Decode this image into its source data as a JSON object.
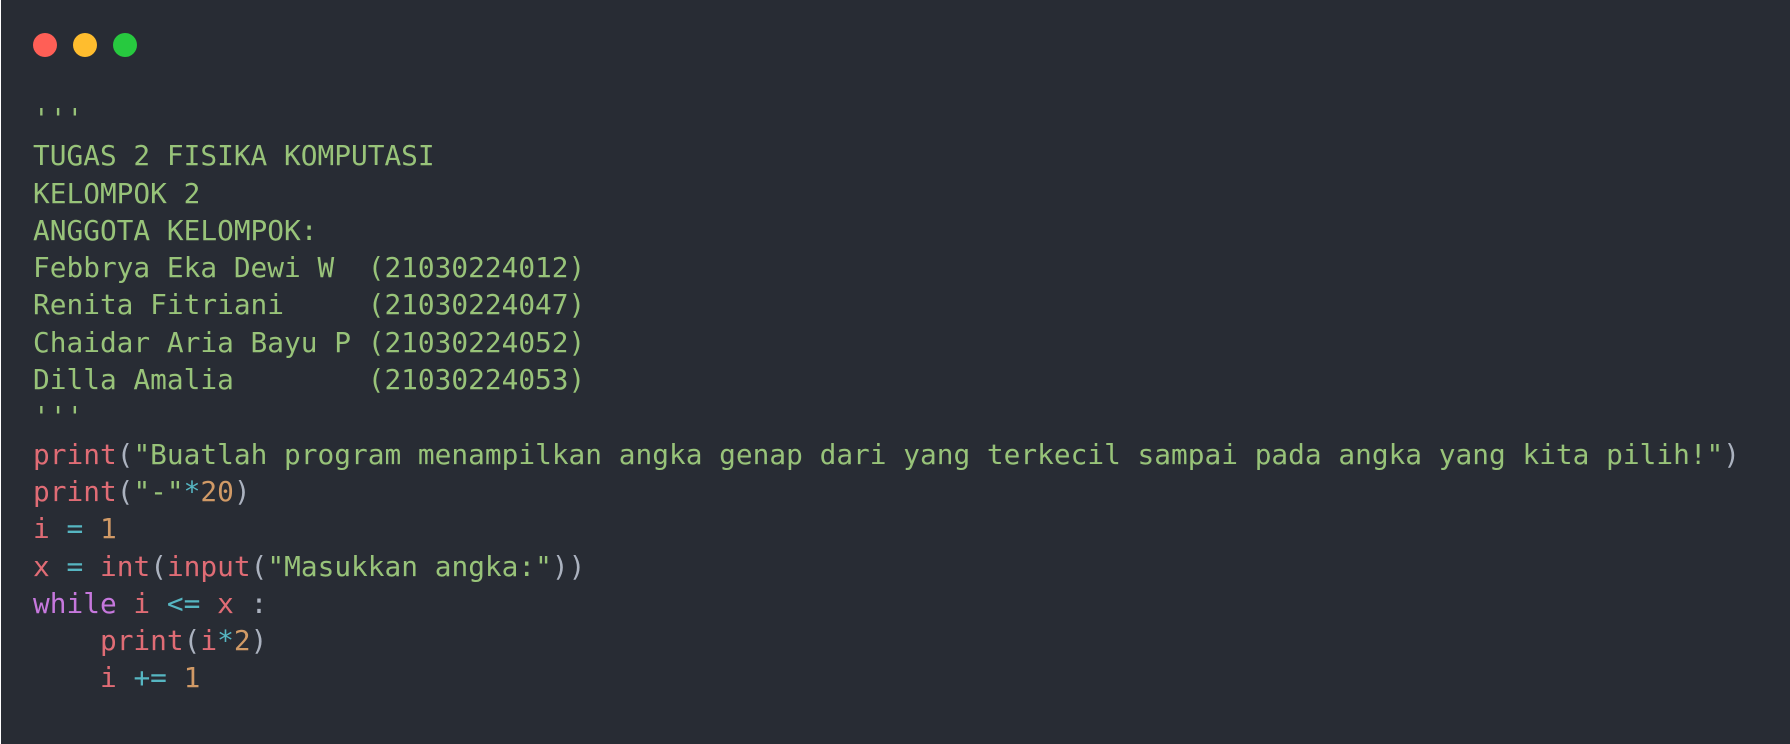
{
  "window": {
    "controls": [
      "close",
      "minimize",
      "maximize"
    ]
  },
  "code": {
    "docstring": {
      "open": "'''",
      "lines": [
        "TUGAS 2 FISIKA KOMPUTASI",
        "KELOMPOK 2",
        "ANGGOTA KELOMPOK:",
        "Febbrya Eka Dewi W  (21030224012)",
        "Renita Fitriani     (21030224047)",
        "Chaidar Aria Bayu P (21030224052)",
        "Dilla Amalia        (21030224053)"
      ],
      "close": "'''"
    },
    "line1": {
      "fn": "print",
      "open": "(",
      "str": "\"Buatlah program menampilkan angka genap dari yang terkecil sampai pada angka yang kita pilih!\"",
      "close": ")"
    },
    "line2": {
      "fn": "print",
      "open": "(",
      "str": "\"-\"",
      "op": "*",
      "num": "20",
      "close": ")"
    },
    "line3": {
      "var": "i",
      "op": " = ",
      "num": "1"
    },
    "line4": {
      "var": "x",
      "op": " = ",
      "fn1": "int",
      "open1": "(",
      "fn2": "input",
      "open2": "(",
      "str": "\"Masukkan angka:\"",
      "close": "))"
    },
    "line5": {
      "kw": "while",
      "var1": " i ",
      "op": "<=",
      "var2": " x ",
      "colon": ":"
    },
    "line6": {
      "indent": "    ",
      "fn": "print",
      "open": "(",
      "var": "i",
      "op": "*",
      "num": "2",
      "close": ")"
    },
    "line7": {
      "indent": "    ",
      "var": "i",
      "op": " += ",
      "num": "1"
    }
  },
  "colors": {
    "background": "#282c34",
    "string": "#98c379",
    "function": "#e06c75",
    "number": "#d19a66",
    "operator": "#56b6c2",
    "keyword": "#c678dd",
    "punctuation": "#abb2bf"
  }
}
